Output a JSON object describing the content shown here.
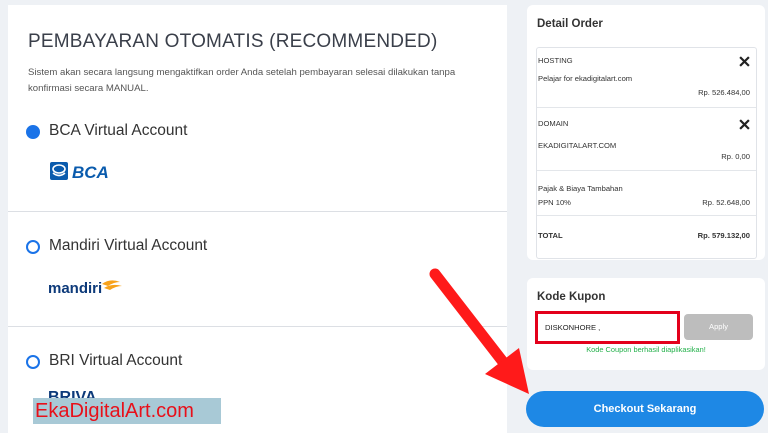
{
  "payment": {
    "title": "PEMBAYARAN OTOMATIS (RECOMMENDED)",
    "description": "Sistem akan secara langsung mengaktifkan order Anda setelah pembayaran selesai dilakukan tanpa konfirmasi secara MANUAL.",
    "methods": [
      {
        "label": "BCA Virtual Account",
        "selected": true,
        "logo_text": "BCA"
      },
      {
        "label": "Mandiri Virtual Account",
        "selected": false,
        "logo_text": "mandiri"
      },
      {
        "label": "BRI Virtual Account",
        "selected": false,
        "logo_text": "BRIVA"
      }
    ]
  },
  "order": {
    "title": "Detail Order",
    "hosting_label": "HOSTING",
    "hosting_item": "Pelajar for ekadigitalart.com",
    "hosting_price": "Rp. 526.484,00",
    "domain_label": "DOMAIN",
    "domain_item": "EKADIGITALART.COM",
    "domain_price": "Rp. 0,00",
    "tax_label": "Pajak & Biaya Tambahan",
    "ppn_label": "PPN 10%",
    "ppn_price": "Rp. 52.648,00",
    "total_label": "TOTAL",
    "total_price": "Rp. 579.132,00"
  },
  "coupon": {
    "title": "Kode Kupon",
    "value": "DISKONHORE ,",
    "apply_label": "Apply",
    "success_message": "Kode Coupon berhasil diaplikasikan!"
  },
  "checkout_label": "Checkout Sekarang",
  "watermark": "EkaDigitalArt.com",
  "colors": {
    "accent": "#1a73e8",
    "checkout": "#1e88e5",
    "highlight": "#e3001b",
    "success": "#23b04a",
    "bca_blue": "#0a5bad",
    "mandiri_blue": "#0d3a7a",
    "mandiri_orange": "#f7a21b"
  },
  "icons": {
    "remove": "close-icon",
    "annotation": "red-arrow-icon"
  }
}
